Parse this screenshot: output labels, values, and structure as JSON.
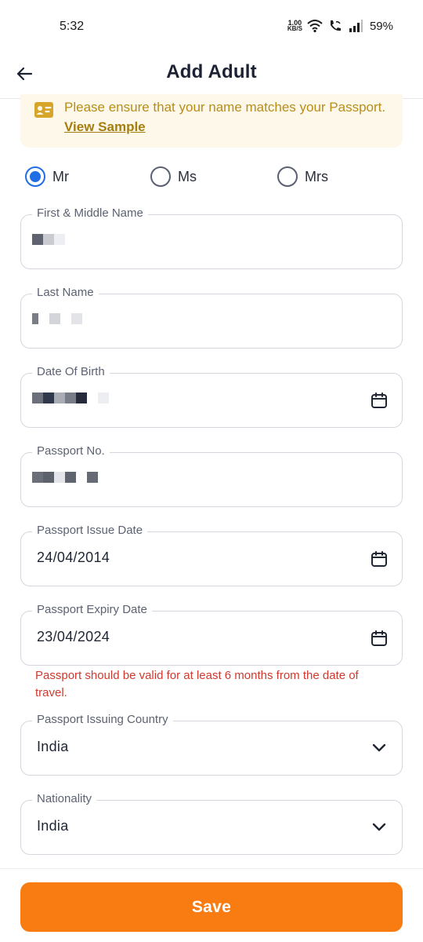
{
  "status_bar": {
    "time": "5:32",
    "net_speed_value": "1.00",
    "net_speed_unit": "KB/S",
    "battery": "59%"
  },
  "header": {
    "title": "Add Adult"
  },
  "notice": {
    "text": "Please ensure that your name matches your Passport.",
    "link": "View Sample"
  },
  "titles": {
    "options": [
      "Mr",
      "Ms",
      "Mrs"
    ],
    "selected": "Mr"
  },
  "fields": {
    "first_middle_name": {
      "label": "First & Middle Name"
    },
    "last_name": {
      "label": "Last Name"
    },
    "date_of_birth": {
      "label": "Date Of Birth"
    },
    "passport_no": {
      "label": "Passport No."
    },
    "passport_issue_date": {
      "label": "Passport Issue Date",
      "value": "24/04/2014"
    },
    "passport_expiry_date": {
      "label": "Passport Expiry Date",
      "value": "23/04/2024"
    },
    "passport_issuing_country": {
      "label": "Passport Issuing Country",
      "value": "India"
    },
    "nationality": {
      "label": "Nationality",
      "value": "India"
    }
  },
  "errors": {
    "passport_expiry": "Passport should be valid for at least 6 months from the date of travel."
  },
  "footer": {
    "save_label": "Save"
  },
  "colors": {
    "accent": "#f97c12",
    "radio_selected": "#1f6ee5",
    "error": "#cf3a2e",
    "notice_bg": "#fef8ea",
    "notice_text": "#b78e1a"
  },
  "icons": {
    "back": "arrow-left-icon",
    "notice": "id-card-icon",
    "calendar": "calendar-icon",
    "dropdown": "chevron-down-icon"
  }
}
